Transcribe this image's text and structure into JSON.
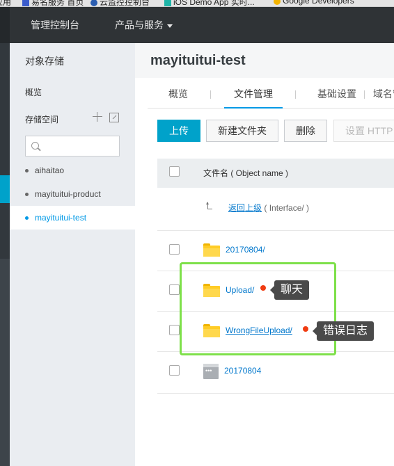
{
  "browser": {
    "bookmarks": [
      {
        "label": "应用",
        "icon": "apps-icon"
      },
      {
        "label": "易名服务 首页",
        "icon": "bookmark-icon"
      },
      {
        "label": "云监控控制台",
        "icon": "cloud-icon"
      },
      {
        "label": "iOS Demo App 实时...",
        "icon": "app-icon"
      },
      {
        "label": "Google Developers",
        "icon": "google-icon"
      }
    ]
  },
  "topnav": {
    "console": "管理控制台",
    "products": "产品与服务"
  },
  "sidebar": {
    "title": "对象存储",
    "overview": "概览",
    "section": "存储空间",
    "search_placeholder": "",
    "buckets": [
      {
        "name": "aihaitao",
        "active": false
      },
      {
        "name": "mayituitui-product",
        "active": false
      },
      {
        "name": "mayituitui-test",
        "active": true
      }
    ]
  },
  "main": {
    "bucket_title": "mayituitui-test",
    "tabs": [
      "概览",
      "文件管理",
      "基础设置",
      "域名管"
    ],
    "active_tab": "文件管理",
    "toolbar": {
      "upload": "上传",
      "new_folder": "新建文件夹",
      "delete": "删除",
      "set_http": "设置 HTTP"
    },
    "table": {
      "header_name": "文件名 ( Object name )",
      "back": {
        "link": "返回上级",
        "path": "( Interface/ )"
      },
      "rows": [
        {
          "name": "20170804/",
          "type": "folder"
        },
        {
          "name": "Upload/",
          "type": "folder"
        },
        {
          "name": "WrongFileUpload/",
          "type": "folder"
        },
        {
          "name": "20170804",
          "type": "file"
        }
      ]
    }
  },
  "annotations": {
    "tip_chat": "聊天",
    "tip_error_log": "错误日志",
    "highlight_color": "#7ee04a",
    "dot_color": "#f03c12"
  },
  "colors": {
    "accent": "#00a2ca",
    "link": "#0077cc",
    "topbar": "#2f3336"
  }
}
